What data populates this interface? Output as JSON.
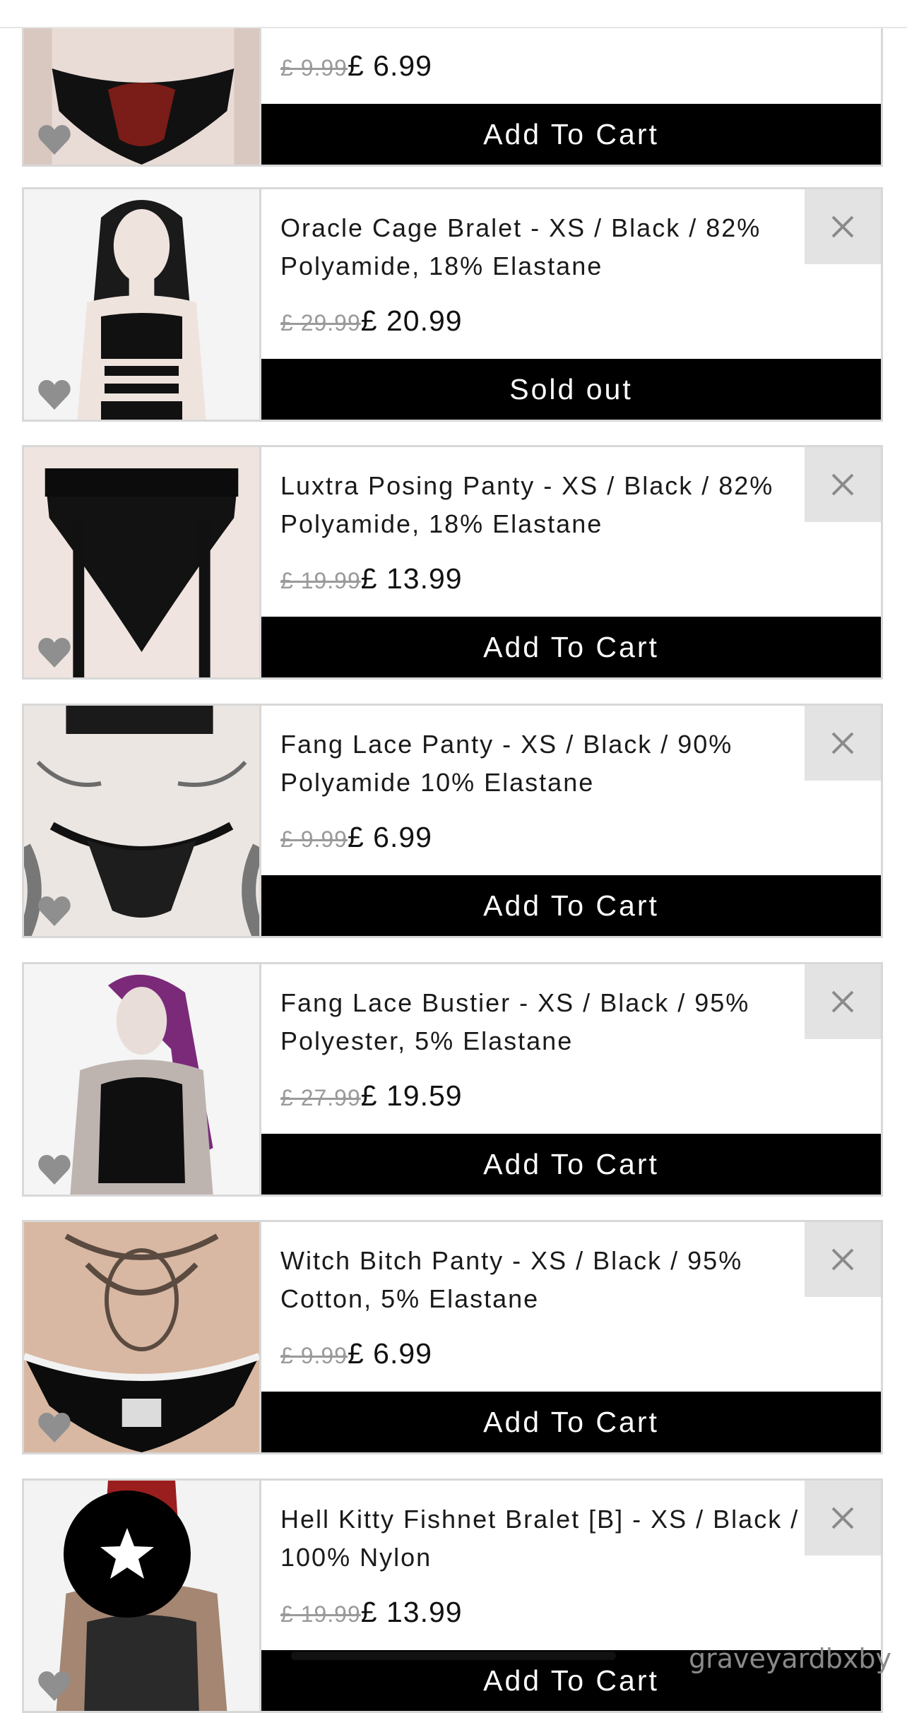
{
  "colors": {
    "button_bg": "#000000",
    "button_text": "#ffffff",
    "remove_bg": "#e3e3e3",
    "old_price": "#9a9a9a",
    "heart": "#8f8f8f"
  },
  "icons": {
    "remove": "close-x-icon",
    "favorite": "heart-icon",
    "fab": "star-icon"
  },
  "items": [
    {
      "title": "",
      "old_price": "£ 9.99",
      "price": "£ 6.99",
      "button": "Add To Cart"
    },
    {
      "title": "Oracle Cage Bralet - XS / Black / 82% Polyamide, 18% Elastane",
      "old_price": "£ 29.99",
      "price": "£ 20.99",
      "button": "Sold out"
    },
    {
      "title": "Luxtra Posing Panty - XS / Black / 82% Polyamide, 18% Elastane",
      "old_price": "£ 19.99",
      "price": "£ 13.99",
      "button": "Add To Cart"
    },
    {
      "title": "Fang Lace Panty - XS / Black / 90% Polyamide 10% Elastane",
      "old_price": "£ 9.99",
      "price": "£ 6.99",
      "button": "Add To Cart"
    },
    {
      "title": "Fang Lace Bustier - XS / Black / 95% Polyester, 5% Elastane",
      "old_price": "£ 27.99",
      "price": "£ 19.59",
      "button": "Add To Cart"
    },
    {
      "title": "Witch Bitch Panty - XS / Black / 95% Cotton, 5% Elastane",
      "old_price": "£ 9.99",
      "price": "£ 6.99",
      "button": "Add To Cart"
    },
    {
      "title": "Hell Kitty Fishnet Bralet [B] - XS / Black / 100% Nylon",
      "old_price": "£ 19.99",
      "price": "£ 13.99",
      "button": "Add To Cart"
    }
  ],
  "watermark": "graveyardbxby"
}
